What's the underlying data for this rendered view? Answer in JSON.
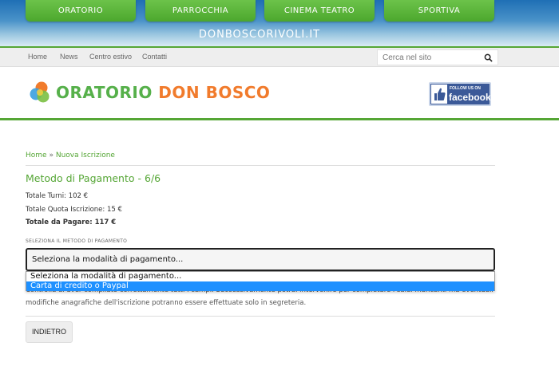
{
  "top_nav": {
    "buttons": [
      "ORATORIO",
      "PARROCCHIA",
      "CINEMA TEATRO",
      "SPORTIVA"
    ],
    "site_domain": "DONBOSCORIVOLI.IT"
  },
  "menu": {
    "links": [
      "Home",
      "News",
      "Centro estivo",
      "Contatti"
    ],
    "search_placeholder": "Cerca nel sito"
  },
  "header": {
    "logo_part1": "ORATORIO",
    "logo_part2": "DON BOSCO",
    "facebook_follow": "FOLLOW US ON",
    "facebook_name": "facebook"
  },
  "breadcrumb": {
    "home": "Home",
    "separator": "»",
    "current": "Nuova Iscrizione"
  },
  "page": {
    "title": "Metodo di Pagamento - 6/6",
    "total_turni": "Totale Turni: 102 €",
    "total_quota": "Totale Quota Iscrizione: 15 €",
    "total_pagare": "Totale da Pagare: 117 €",
    "payment_label": "SELEZIONA IL METODO DI PAGAMENTO",
    "payment_selected": "Seleziona la modalità di pagamento...",
    "payment_options": [
      "Seleziona la modalità di pagamento...",
      "Carta di credito o Paypal"
    ],
    "highlighted_option_index": 1,
    "note_line1": "Controlla di aver compilato correttamente tutti i campi. Successivamente potrai intervenire per completare i saldi mancanti ma eventuali",
    "note_line2": "modifiche anagrafiche dell'iscrizione potranno essere effettuate solo in segreteria.",
    "back_label": "INDIETRO"
  },
  "colors": {
    "accent_green": "#55a635",
    "logo_orange": "#f17b2c",
    "facebook_blue": "#3b5998",
    "highlight_blue": "#1e90ff"
  }
}
